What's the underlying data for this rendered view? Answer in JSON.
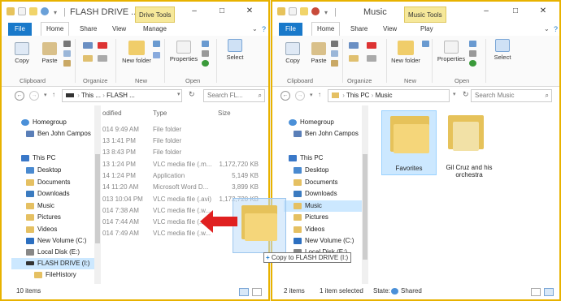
{
  "left": {
    "title": "FLASH DRIVE ...",
    "context_tab": "Drive Tools",
    "tabs": [
      "File",
      "Home",
      "Share",
      "View",
      "Manage"
    ],
    "ribbon": {
      "copy": "Copy",
      "paste": "Paste",
      "new_folder": "New folder",
      "properties": "Properties",
      "select": "Select",
      "groups": [
        "Clipboard",
        "Organize",
        "New",
        "Open"
      ]
    },
    "address": {
      "seg1": "This ...",
      "seg2": "FLASH ...",
      "search_placeholder": "Search FL..."
    },
    "nav": [
      "Homegroup",
      "Ben John Campos",
      "This PC",
      "Desktop",
      "Documents",
      "Downloads",
      "Music",
      "Pictures",
      "Videos",
      "New Volume (C:)",
      "Local Disk (E:)",
      "FLASH DRIVE (I:)",
      "FileHistory"
    ],
    "headers": {
      "modified": "odified",
      "type": "Type",
      "size": "Size"
    },
    "rows": [
      {
        "date": "014 9:49 AM",
        "type": "File folder",
        "size": ""
      },
      {
        "date": "13 1:41 PM",
        "type": "File folder",
        "size": ""
      },
      {
        "date": "13 8:43 PM",
        "type": "File folder",
        "size": ""
      },
      {
        "date": "13 1:24 PM",
        "type": "VLC media file (.m...",
        "size": "1,172,720 KB"
      },
      {
        "date": "14 1:24 PM",
        "type": "Application",
        "size": "5,149 KB"
      },
      {
        "date": "14 11:20 AM",
        "type": "Microsoft Word D...",
        "size": "3,899 KB"
      },
      {
        "date": "013 10:04 PM",
        "type": "VLC media file (.avi)",
        "size": "1,172,720 KB"
      },
      {
        "date": "014 7:38 AM",
        "type": "VLC media file (.w...",
        "size": "84,8"
      },
      {
        "date": "014 7:44 AM",
        "type": "VLC media file (...",
        "size": ""
      },
      {
        "date": "014 7:49 AM",
        "type": "VLC media file (.w...",
        "size": "131,9"
      }
    ],
    "status": "10 items"
  },
  "right": {
    "title": "Music",
    "context_tab": "Music Tools",
    "tabs": [
      "File",
      "Home",
      "Share",
      "View",
      "Play"
    ],
    "ribbon": {
      "copy": "Copy",
      "paste": "Paste",
      "new_folder": "New folder",
      "properties": "Properties",
      "select": "Select",
      "groups": [
        "Clipboard",
        "Organize",
        "New",
        "Open"
      ]
    },
    "address": {
      "seg1": "This PC",
      "seg2": "Music",
      "search_placeholder": "Search Music"
    },
    "nav": [
      "Homegroup",
      "Ben John Campos",
      "This PC",
      "Desktop",
      "Documents",
      "Downloads",
      "Music",
      "Pictures",
      "Videos",
      "New Volume (C:)",
      "Local Disk (E:)"
    ],
    "folders": [
      {
        "name": "Favorites"
      },
      {
        "name": "Gil Cruz and his orchestra"
      }
    ],
    "status": {
      "count": "2 items",
      "selected": "1 item selected",
      "state_label": "State:",
      "state_value": "Shared"
    }
  },
  "drag": {
    "tooltip": "Copy to FLASH DRIVE (I:)"
  },
  "colors": {
    "file_tab": "#1979ca",
    "context_tab": "#f6e89a",
    "window_border": "#e8b200",
    "arrow": "#e02020",
    "selection": "#cce8ff"
  }
}
